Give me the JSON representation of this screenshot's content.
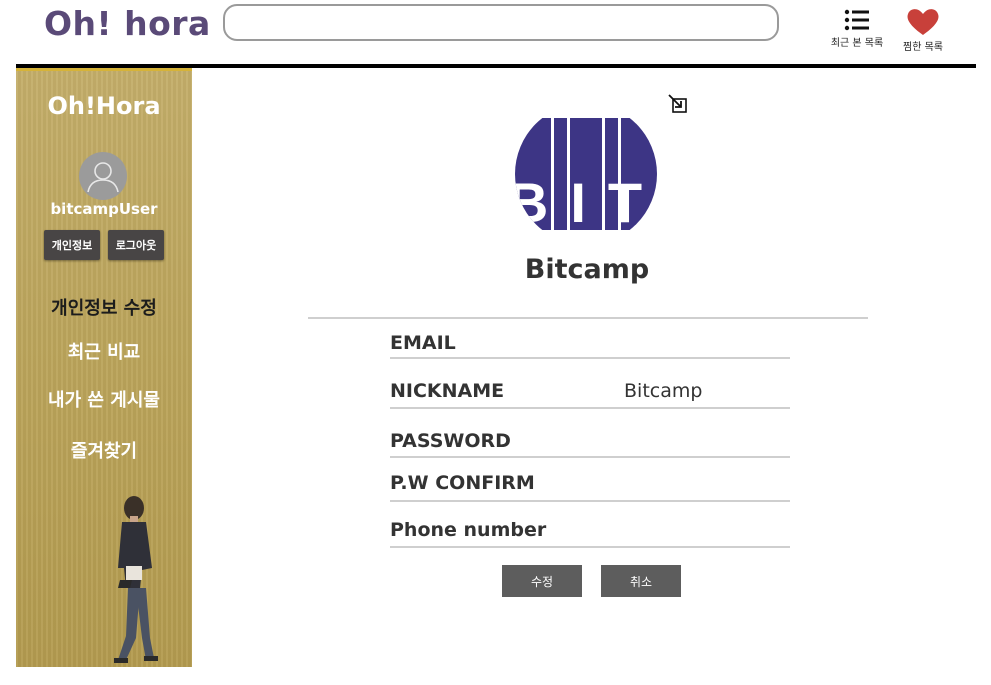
{
  "header": {
    "logo": "Oh! hora",
    "search_value": "",
    "recent_label": "최근 본 목록",
    "wishlist_label": "찜한 목록"
  },
  "sidebar": {
    "title": "Oh!Hora",
    "username": "bitcampUser",
    "info_button": "개인정보",
    "logout_button": "로그아웃",
    "menu": [
      {
        "label": "개인정보 수정",
        "active": true
      },
      {
        "label": "최근 비교",
        "active": false
      },
      {
        "label": "내가 쓴 게시물",
        "active": false
      },
      {
        "label": "즐겨찾기",
        "active": false
      }
    ]
  },
  "profile": {
    "logo_text": "BIT",
    "name": "Bitcamp"
  },
  "form": {
    "fields": [
      {
        "label": "EMAIL",
        "value": ""
      },
      {
        "label": "NICKNAME",
        "value": "Bitcamp"
      },
      {
        "label": "PASSWORD",
        "value": ""
      },
      {
        "label": "P.W CONFIRM",
        "value": ""
      },
      {
        "label": "Phone number",
        "value": ""
      }
    ],
    "save_button": "수정",
    "cancel_button": "취소"
  },
  "colors": {
    "logo": "#5a4a78",
    "sidebar": "#bca55c",
    "bit_logo": "#3d3585",
    "heart": "#c8403a",
    "button": "#5d5d5d"
  },
  "icons": {
    "recent": "list-icon",
    "wishlist": "heart-icon",
    "resize": "resize-icon",
    "avatar": "user-silhouette-icon"
  }
}
